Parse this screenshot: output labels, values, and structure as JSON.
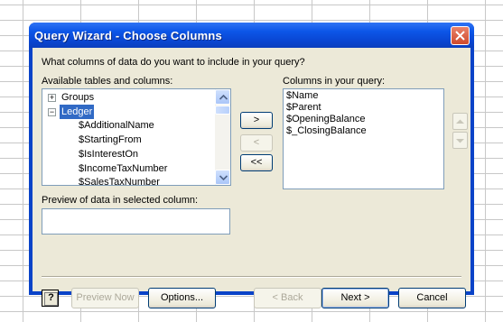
{
  "window": {
    "title": "Query Wizard - Choose Columns"
  },
  "prompt": "What columns of data do you want to include in your query?",
  "available": {
    "label": "Available tables and columns:",
    "tree": [
      {
        "label": "Groups",
        "expander": "+"
      },
      {
        "label": "Ledger",
        "expander": "−",
        "selected": true
      },
      {
        "label": "$AdditionalName"
      },
      {
        "label": "$StartingFrom"
      },
      {
        "label": "$IsInterestOn"
      },
      {
        "label": "$IncomeTaxNumber"
      },
      {
        "label": "$SalesTaxNumber"
      }
    ]
  },
  "query_columns": {
    "label": "Columns in your query:",
    "items": [
      "$Name",
      "$Parent",
      "$OpeningBalance",
      "$_ClosingBalance"
    ]
  },
  "move_buttons": {
    "add": ">",
    "remove": "<",
    "remove_all": "<<"
  },
  "preview": {
    "label": "Preview of data in selected column:",
    "value": ""
  },
  "footer": {
    "help": "?",
    "preview_now": "Preview Now",
    "options": "Options...",
    "back": "< Back",
    "next": "Next >",
    "cancel": "Cancel"
  },
  "colors": {
    "title_bar": "#0a47d4",
    "dialog_bg": "#ece9d8",
    "selection": "#316ac5"
  },
  "icons": {
    "close": "close-icon",
    "scroll_up": "arrow-up-icon",
    "scroll_down": "arrow-down-icon"
  }
}
